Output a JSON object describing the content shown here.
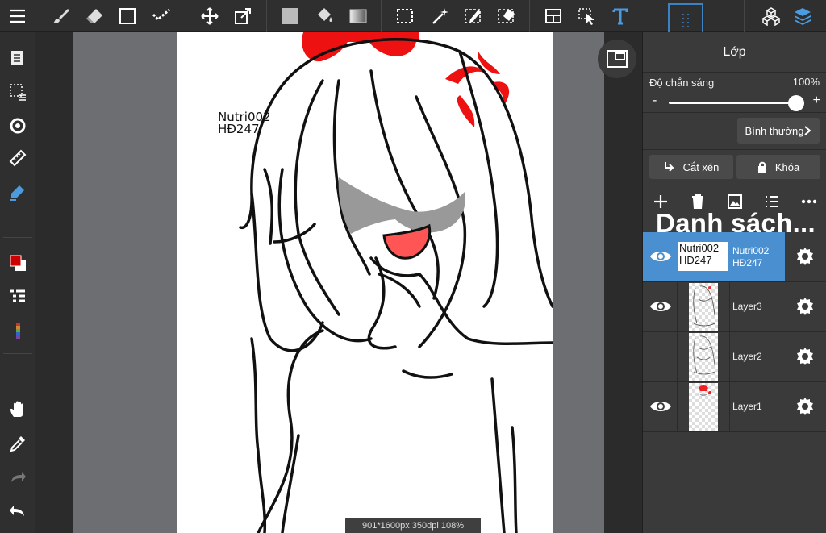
{
  "panel": {
    "title": "Lớp",
    "opacity_label": "Độ chắn sáng",
    "opacity_value": "100%",
    "opacity_fraction": 1.0,
    "slider_minus": "-",
    "slider_plus": "+",
    "blend_mode": "Bình thường",
    "clip_label": "Cắt xén",
    "lock_label": "Khóa",
    "list_title": "Danh sách..."
  },
  "layers": [
    {
      "name": "Nutri002\nHĐ247",
      "thumb_text": "Nutri002\nHĐ247",
      "visible": true,
      "selected": true
    },
    {
      "name": "Layer3",
      "visible": true,
      "selected": false
    },
    {
      "name": "Layer2",
      "visible": false,
      "selected": false
    },
    {
      "name": "Layer1",
      "visible": true,
      "selected": false
    }
  ],
  "canvas": {
    "note": "Nutri002\nHĐ247",
    "status": "901*1600px 350dpi 108%"
  },
  "icons": {
    "top": [
      "menu-icon",
      "brush-icon",
      "eraser-icon",
      "rectangle-icon",
      "dot-pen-icon",
      "move-icon",
      "transform-icon",
      "fill-color-icon",
      "bucket-icon",
      "gradient-icon",
      "select-rect-icon",
      "magic-wand-icon",
      "select-pen-icon",
      "select-eraser-icon",
      "panel-layout-icon",
      "pointer-icon",
      "text-icon",
      "grid-dots-icon",
      "materials-icon",
      "layers-icon"
    ],
    "left": [
      "pages-icon",
      "selection-icon",
      "rotate-icon",
      "ruler-icon",
      "pen-icon",
      "color-swatch-icon",
      "layer-list-icon",
      "color-gradient-icon",
      "hand-icon",
      "eyedropper-icon",
      "redo-icon",
      "undo-icon"
    ]
  },
  "colors": {
    "accent": "#4a90d0",
    "panel": "#3a3a3a",
    "toolbar": "#2f2f2f",
    "red_hair": "#ee1111"
  }
}
